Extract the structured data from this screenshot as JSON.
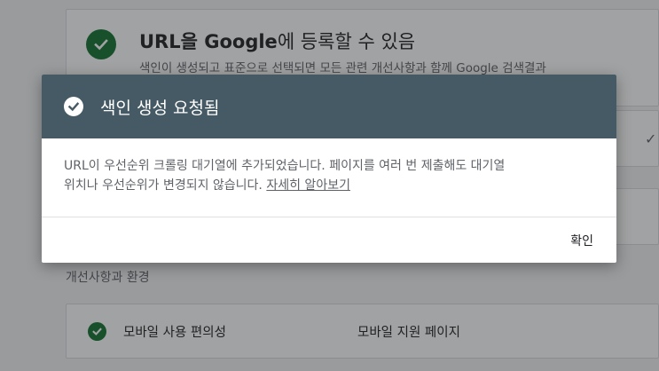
{
  "background": {
    "top_card": {
      "title_bold": "URL을 Google",
      "title_rest": "에 등록할 수 있음",
      "description": "색인이 생성되고 표준으로 선택되면 모든 관련 개선사항과 함께 Google 검색결과"
    },
    "section_label": "개선사항과 환경",
    "bottom_card": {
      "name": "모바일 사용 편의성",
      "status": "모바일 지원 페이지"
    }
  },
  "dialog": {
    "title": "색인 생성 요청됨",
    "body_line1": "URL이 우선순위 크롤링 대기열에 추가되었습니다. 페이지를 여러 번 제출해도 대기열",
    "body_line2": "위치나 우선순위가 변경되지 않습니다. ",
    "learn_more": "자세히 알아보기",
    "ok_button": "확인"
  },
  "colors": {
    "header_bg": "#455a64",
    "success_green": "#137333",
    "scrim": "rgba(32,33,36,0.42)"
  },
  "icons": {
    "dialog_check": "check-circle-icon",
    "status_check": "check-circle-icon"
  }
}
